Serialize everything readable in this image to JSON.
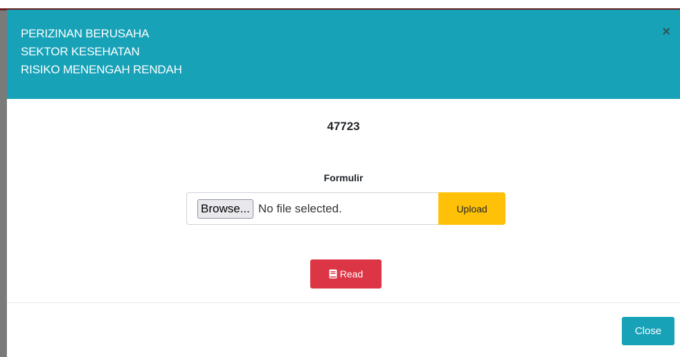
{
  "modal": {
    "title_lines": [
      "PERIZINAN BERUSAHA",
      "SEKTOR KESEHATAN",
      "RISIKO MENENGAH RENDAH"
    ],
    "close_symbol": "×",
    "record_number": "47723",
    "form_label": "Formulir",
    "file_input": {
      "browse_label": "Browse...",
      "status": "No file selected."
    },
    "upload_label": "Upload",
    "read_label": "Read",
    "read_icon": "book-icon",
    "close_label": "Close"
  },
  "colors": {
    "header": "#17a2b8",
    "upload": "#ffc107",
    "read": "#dc3545",
    "close": "#17a2b8"
  }
}
